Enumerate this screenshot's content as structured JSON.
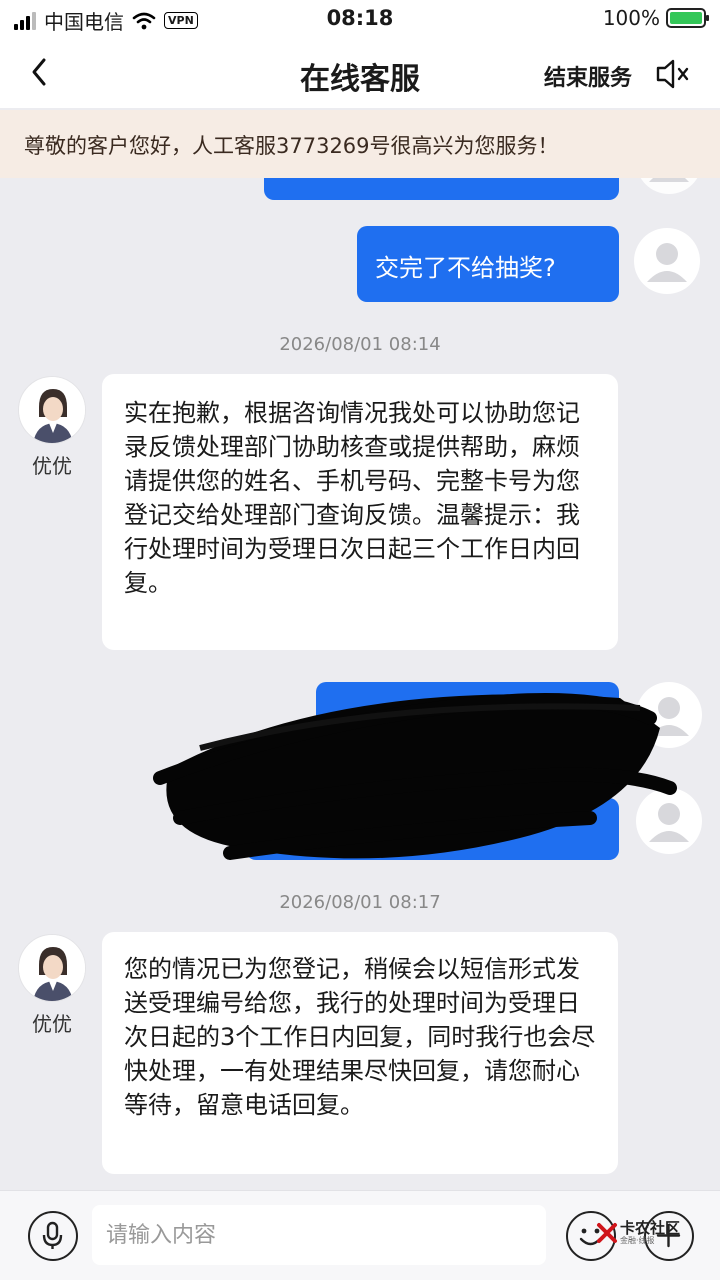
{
  "status_bar": {
    "carrier": "中国电信",
    "vpn": "VPN",
    "time": "08:18",
    "battery": "100%"
  },
  "nav": {
    "title": "在线客服",
    "end_service": "结束服务"
  },
  "notice": "尊敬的客户您好，人工客服3773269号很高兴为您服务！",
  "messages": {
    "user1": "交完了不给抽奖?",
    "ts1": "2026/08/01 08:14",
    "agent1": "实在抱歉，根据咨询情况我处可以协助您记录反馈处理部门协助核查或提供帮助，麻烦请提供您的姓名、手机号码、完整卡号为您登记交给处理部门查询反馈。温馨提示：我行处理时间为受理日次日起三个工作日内回复。",
    "agent_name": "优优",
    "ts2": "2026/08/01 08:17",
    "agent2": "您的情况已为您登记，稍候会以短信形式发送受理编号给您，我行的处理时间为受理日次日起的3个工作日内回复，同时我行也会尽快处理，一有处理结果尽快回复，请您耐心等待，留意电话回复。"
  },
  "input": {
    "placeholder": "请输入内容"
  },
  "watermark": {
    "brand": "卡农社区",
    "sub": "金融·线报"
  },
  "colors": {
    "user_bubble": "#1f6ff0",
    "agent_bubble": "#ffffff",
    "notice_bg": "#f6ece4",
    "chat_bg": "#ececf0"
  }
}
